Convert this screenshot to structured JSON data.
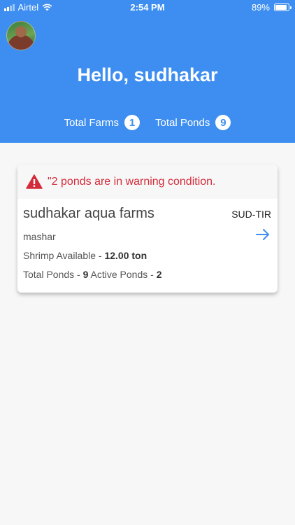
{
  "status_bar": {
    "carrier": "Airtel",
    "time": "2:54 PM",
    "battery": "89%"
  },
  "header": {
    "greeting": "Hello, sudhakar",
    "stats": [
      {
        "label": "Total Farms",
        "count": "1"
      },
      {
        "label": "Total Ponds",
        "count": "9"
      }
    ]
  },
  "farm_card": {
    "alert_text": "\"2 ponds are in warning condition.",
    "name": "sudhakar aqua farms",
    "code": "SUD-TIR",
    "location": "mashar",
    "shrimp_label": "Shrimp Available - ",
    "shrimp_value": "12.00 ton",
    "total_ponds_label": "Total Ponds - ",
    "total_ponds_value": "9",
    "active_ponds_label": " Active Ponds - ",
    "active_ponds_value": "2"
  },
  "colors": {
    "header_blue": "#3d8ef0",
    "alert_red": "#d42b3a"
  },
  "icons": {
    "wifi": "wifi-icon",
    "signal": "signal-icon",
    "battery": "battery-icon",
    "warning": "warning-icon",
    "arrow": "arrow-right-icon"
  }
}
